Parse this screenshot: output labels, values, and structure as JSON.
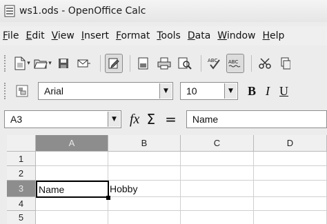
{
  "window": {
    "title": "ws1.ods - OpenOffice Calc"
  },
  "menu": [
    {
      "label": "File",
      "acc": "F",
      "rest": "ile"
    },
    {
      "label": "Edit",
      "acc": "E",
      "rest": "dit"
    },
    {
      "label": "View",
      "acc": "V",
      "rest": "iew"
    },
    {
      "label": "Insert",
      "acc": "I",
      "rest": "nsert"
    },
    {
      "label": "Format",
      "acc": "F",
      "rest": "ormat"
    },
    {
      "label": "Tools",
      "acc": "T",
      "rest": "ools"
    },
    {
      "label": "Data",
      "acc": "D",
      "rest": "ata"
    },
    {
      "label": "Window",
      "acc": "W",
      "rest": "indow"
    },
    {
      "label": "Help",
      "acc": "H",
      "rest": "elp"
    }
  ],
  "format_bar": {
    "font_name": "Arial",
    "font_size": "10",
    "bold_label": "B",
    "italic_label": "I",
    "underline_label": "U"
  },
  "formula_bar": {
    "name_box": "A3",
    "fx_label": "fx",
    "sum_label": "Σ",
    "equals_label": "=",
    "content": "Name"
  },
  "sheet": {
    "columns": [
      "A",
      "B",
      "C",
      "D"
    ],
    "rows": [
      "1",
      "2",
      "3",
      "4",
      "5"
    ],
    "active_cell": "A3",
    "cells": {
      "A3": "Name",
      "B3": "Hobby"
    }
  },
  "icons": [
    "new-document-icon",
    "open-folder-icon",
    "save-icon",
    "email-icon",
    "edit-file-icon",
    "export-pdf-icon",
    "print-icon",
    "page-preview-icon",
    "spellcheck-icon",
    "autospellcheck-icon",
    "cut-icon",
    "copy-icon",
    "styles-icon"
  ]
}
